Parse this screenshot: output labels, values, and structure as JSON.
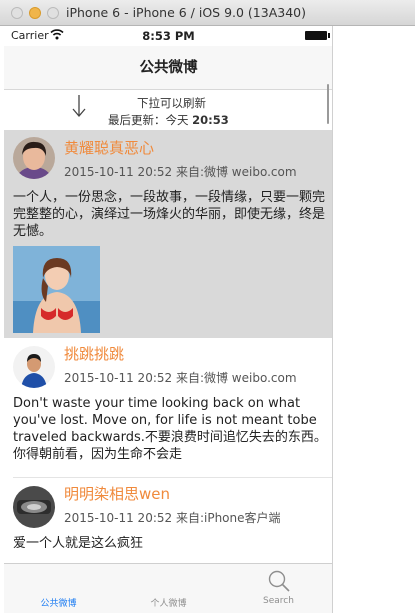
{
  "window": {
    "title": "iPhone 6 - iPhone 6 / iOS 9.0 (13A340)"
  },
  "status_bar": {
    "carrier": "Carrier",
    "time": "8:53 PM"
  },
  "nav": {
    "title": "公共微博"
  },
  "refresh": {
    "hint": "下拉可以刷新",
    "last_update_label": "最后更新：今天",
    "last_update_time": "20:53"
  },
  "posts": [
    {
      "username": "黄耀聪真恶心",
      "meta": "2015-10-11 20:52 来自:微博 weibo.com",
      "text": "一个人，一份思念，一段故事，一段情缘，只要一颗完完整整的心，演绎过一场烽火的华丽，即使无缘，终是无憾。"
    },
    {
      "username": "挑跳挑跳",
      "meta": "2015-10-11 20:52 来自:微博 weibo.com",
      "text": "Don't waste your time looking back on what you've lost. Move on, for life is not meant tobe traveled backwards.不要浪费时间追忆失去的东西。你得朝前看，因为生命不会走"
    },
    {
      "username": "明明染相思wen",
      "meta": "2015-10-11 20:52 来自:iPhone客户端",
      "text": "爱一个人就是这么疯狂"
    }
  ],
  "tabs": [
    {
      "label": "公共微博",
      "active": true
    },
    {
      "label": "个人微博",
      "active": false
    },
    {
      "label": "Search",
      "active": false,
      "icon": "search-icon"
    }
  ],
  "colors": {
    "username": "#f08a3c",
    "active_tab": "#1d7cf2",
    "highlight": "#d9d9d9"
  }
}
